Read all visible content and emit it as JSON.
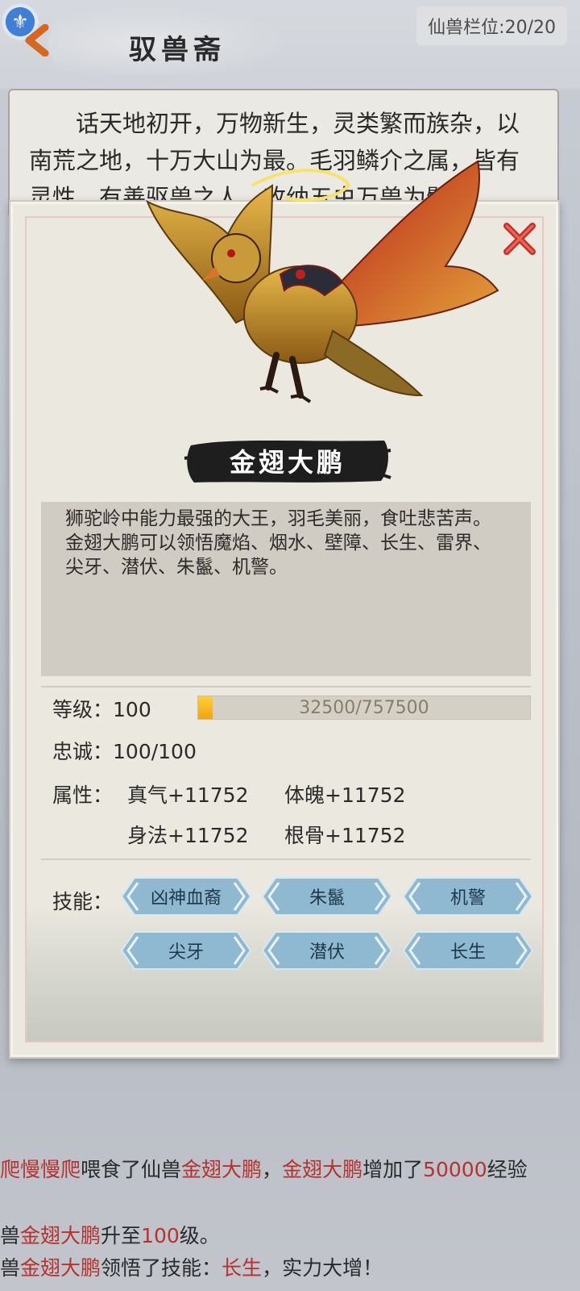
{
  "header": {
    "title": "驭兽斋",
    "slots_label": "仙兽栏位:20/20",
    "compass_glyph": "⚜"
  },
  "intro": {
    "text": "话天地初开，万物新生，灵类繁而族杂，以南荒之地，十万大山为最。毛羽鳞介之属，皆有灵性。有善驱兽之人，收纳五虫万兽为臂助"
  },
  "modal": {
    "beast_name": "金翅大鹏",
    "description": {
      "line1": "狮驼岭中能力最强的大王，羽毛美丽，食吐悲苦声。",
      "line2": "金翅大鹏可以领悟魔焰、烟水、壁障、长生、雷界、尖牙、潜伏、朱鬣、机警。"
    },
    "level": {
      "label": "等级：",
      "value": "100",
      "exp_text": "32500/757500",
      "exp_fraction": 0.0429
    },
    "loyalty": {
      "label": "忠诚：",
      "value": "100/100"
    },
    "attributes": {
      "label": "属性：",
      "items": [
        "真气+11752",
        "体魄+11752",
        "身法+11752",
        "根骨+11752"
      ]
    },
    "skills": {
      "label": "技能：",
      "items": [
        "凶神血裔",
        "朱鬣",
        "机警",
        "尖牙",
        "潜伏",
        "长生"
      ]
    }
  },
  "log": {
    "line1": {
      "p1": "爬慢慢爬",
      "p2": "喂食了仙兽",
      "p3": "金翅大鹏",
      "p4": "，",
      "p5": "金翅大鹏",
      "p6": "增加了",
      "p7": "50000",
      "p8": "经验"
    },
    "line2": {
      "p1": "兽",
      "p2": "金翅大鹏",
      "p3": "升至",
      "p4": "100",
      "p5": "级。"
    },
    "line3": {
      "p1": "兽",
      "p2": "金翅大鹏",
      "p3": "领悟了技能：",
      "p4": "长生",
      "p5": "，实力大增！"
    }
  },
  "colors": {
    "highlight_red": "#b5322e",
    "exp_fill": "#f0a410",
    "skill_button": "#8fb9d0"
  }
}
